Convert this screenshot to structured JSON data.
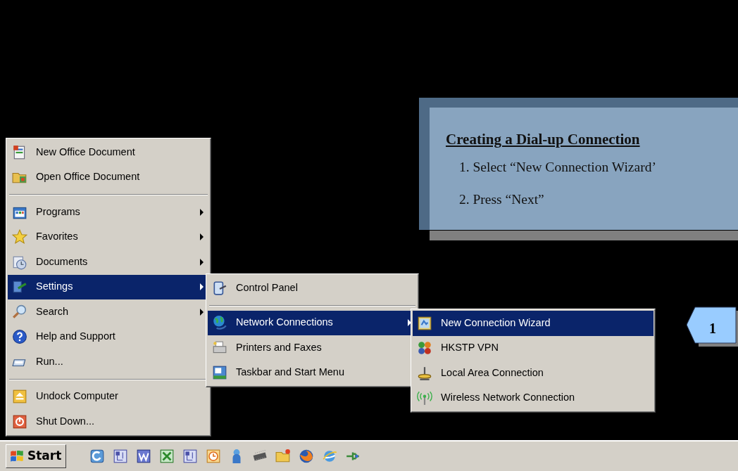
{
  "start_menu": {
    "items": [
      {
        "kind": "item",
        "label": "New Office Document",
        "has_submenu": false,
        "selected": false
      },
      {
        "kind": "item",
        "label": "Open Office Document",
        "has_submenu": false,
        "selected": false
      },
      {
        "kind": "separator"
      },
      {
        "kind": "item",
        "label": "Programs",
        "has_submenu": true,
        "selected": false
      },
      {
        "kind": "item",
        "label": "Favorites",
        "has_submenu": true,
        "selected": false
      },
      {
        "kind": "item",
        "label": "Documents",
        "has_submenu": true,
        "selected": false
      },
      {
        "kind": "item",
        "label": "Settings",
        "has_submenu": true,
        "selected": true
      },
      {
        "kind": "item",
        "label": "Search",
        "has_submenu": true,
        "selected": false
      },
      {
        "kind": "item",
        "label": "Help and Support",
        "has_submenu": false,
        "selected": false
      },
      {
        "kind": "item",
        "label": "Run...",
        "has_submenu": false,
        "selected": false
      },
      {
        "kind": "separator"
      },
      {
        "kind": "item",
        "label": "Undock Computer",
        "has_submenu": false,
        "selected": false
      },
      {
        "kind": "item",
        "label": "Shut Down...",
        "has_submenu": false,
        "selected": false
      }
    ]
  },
  "settings_menu": {
    "items": [
      {
        "kind": "item",
        "label": "Control Panel",
        "has_submenu": false,
        "selected": false
      },
      {
        "kind": "separator"
      },
      {
        "kind": "item",
        "label": "Network Connections",
        "has_submenu": true,
        "selected": true
      },
      {
        "kind": "item",
        "label": "Printers and Faxes",
        "has_submenu": false,
        "selected": false
      },
      {
        "kind": "item",
        "label": "Taskbar and Start Menu",
        "has_submenu": false,
        "selected": false
      }
    ]
  },
  "network_menu": {
    "items": [
      {
        "kind": "item",
        "label": "New Connection Wizard",
        "has_submenu": false,
        "selected": true
      },
      {
        "kind": "item",
        "label": "HKSTP VPN",
        "has_submenu": false,
        "selected": false
      },
      {
        "kind": "item",
        "label": "Local Area Connection",
        "has_submenu": false,
        "selected": false
      },
      {
        "kind": "item",
        "label": "Wireless Network Connection",
        "has_submenu": false,
        "selected": false
      }
    ]
  },
  "taskbar": {
    "start_button": "Start"
  },
  "callout": {
    "title": "Creating a Dial-up Connection",
    "steps": [
      "1. Select “New Connection Wizard’",
      "2. Press “Next”"
    ]
  },
  "step_marker": {
    "label": "1"
  }
}
